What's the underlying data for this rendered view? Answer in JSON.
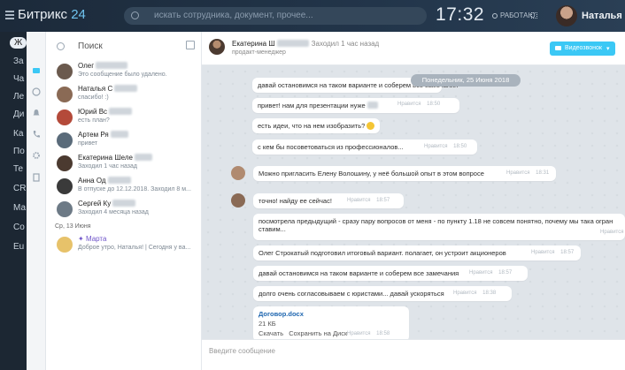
{
  "topbar": {
    "brand_name": "Битрикс",
    "brand_num": "24",
    "search_placeholder": "искать сотрудника, документ, прочее...",
    "clock": "17:32",
    "work_status": "РАБОТАЮ",
    "user_name": "Наталья"
  },
  "bg_menu": [
    "Ж",
    "За",
    "Ча",
    "Ле",
    "Ди",
    "Ка",
    "По",
    "Те",
    "CR",
    "Ма",
    "Со",
    "Eu"
  ],
  "chat_list": {
    "search_label": "Поиск",
    "items": [
      {
        "name": "Олег",
        "sub": "Это сообщение было удалено.",
        "color": "#6b5a4e"
      },
      {
        "name": "Наталья С",
        "sub": "спасибо! :)",
        "color": "#8a6a55"
      },
      {
        "name": "Юрий Вс",
        "sub": "есть план?",
        "color": "#b44a3a"
      },
      {
        "name": "Артем Ря",
        "sub": "привет",
        "color": "#5a6b7a"
      },
      {
        "name": "Екатерина Шеле",
        "sub": "Заходил 1 час назад",
        "color": "#4b3a30"
      },
      {
        "name": "Анна Од",
        "sub": "В отпуске до 12.12.2018. Заходил 8 м...",
        "color": "#3a3a3a"
      },
      {
        "name": "Сергей Ку",
        "sub": "Заходил 4 месяца назад",
        "color": "#6d7a86"
      }
    ],
    "date_sep": "Ср, 13 Июня",
    "marta": {
      "name": "Марта",
      "sub": "Доброе утро, Наталья! | Сегодня у ва..."
    }
  },
  "header": {
    "name": "Екатерина Ш",
    "last_seen": "Заходил 1 час назад",
    "role": "продакт-менеджер",
    "video_call": "Видеозвонок"
  },
  "messages": {
    "date_pill": "Понедельник, 25 Июня 2018",
    "like_label": "Нравится",
    "items": [
      {
        "text": "давай остановимся на таком варианте и соберем все замечания",
        "time": ""
      },
      {
        "text": "привет! нам для презентации нуже",
        "time": "18:50"
      },
      {
        "text": "есть идеи, что на нем изобразить?",
        "time": ""
      },
      {
        "text": "с кем бы посоветоваться из профессионалов...",
        "time": "18:50"
      },
      {
        "text": "Можно пригласить Елену Волошину, у неё большой опыт в этом вопросе",
        "time": "18:31"
      },
      {
        "text": "точно! найду ее сейчас!",
        "time": "18:57"
      },
      {
        "text": "посмотрела предыдущий - сразу пару вопросов от меня - по пункту 1.18 не совсем понятно, почему мы така огран",
        "text2": "ставим...",
        "time": ""
      },
      {
        "text": "Олег Строкатый подготовил итоговый вариант. полагает, он устроит акционеров",
        "time": "18:57"
      },
      {
        "text": "давай остановимся на таком варианте и соберем все замечания",
        "time": "18:57"
      },
      {
        "text": "долго очень согласовываем с юристами... давай ускоряться",
        "time": "18:38"
      }
    ],
    "file": {
      "name": "Договор.docx",
      "size": "21 КБ",
      "download": "Скачать",
      "save": "Сохранить на Диск",
      "time": "18:58"
    }
  },
  "input": {
    "placeholder": "Введите сообщение"
  }
}
